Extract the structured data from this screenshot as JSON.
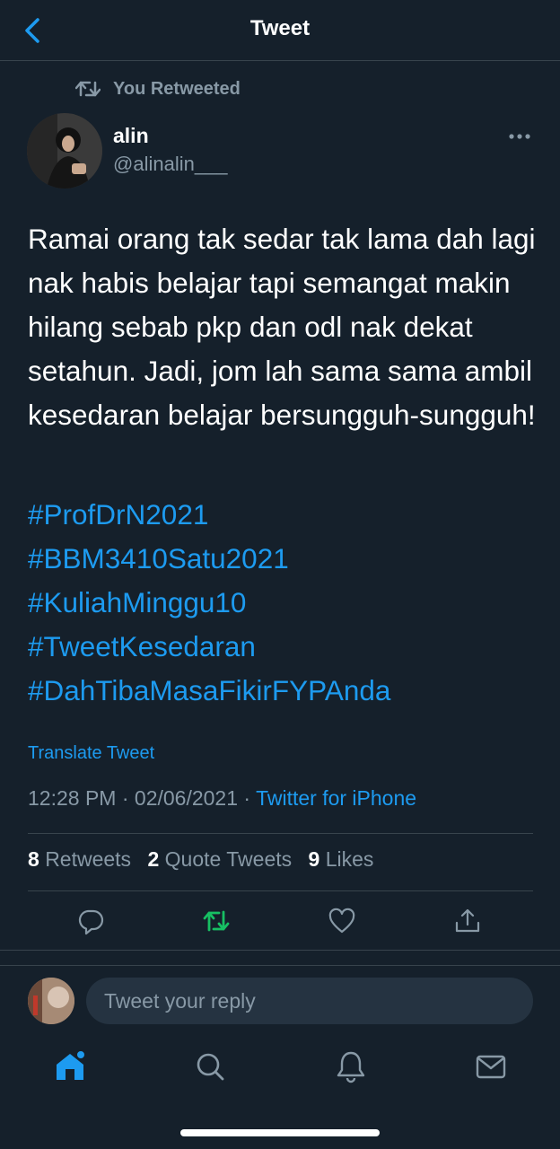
{
  "header": {
    "title": "Tweet",
    "back_icon": "chevron-left-icon"
  },
  "retweet_banner": {
    "icon": "retweet-icon",
    "label": "You Retweeted"
  },
  "author": {
    "name": "alin",
    "handle": "@alinalin___"
  },
  "tweet": {
    "text": "Ramai orang tak sedar tak lama dah lagi nak habis belajar tapi semangat makin hilang sebab pkp dan odl nak dekat setahun. Jadi, jom lah sama sama ambil kesedaran belajar bersungguh-sungguh!",
    "hashtags": [
      "#ProfDrN2021",
      "#BBM3410Satu2021",
      "#KuliahMinggu10",
      "#TweetKesedaran",
      "#DahTibaMasaFikirFYPAnda"
    ],
    "translate_label": "Translate Tweet",
    "time": "12:28 PM",
    "separator": "·",
    "date": "02/06/2021",
    "client": "Twitter for iPhone"
  },
  "stats": {
    "retweets_count": "8",
    "retweets_label": "Retweets",
    "quotes_count": "2",
    "quotes_label": "Quote Tweets",
    "likes_count": "9",
    "likes_label": "Likes"
  },
  "actions": [
    "reply-icon",
    "retweet-icon",
    "like-icon",
    "share-icon"
  ],
  "reply": {
    "placeholder": "Tweet your reply"
  },
  "tabbar": [
    "home-icon",
    "search-icon",
    "notifications-icon",
    "messages-icon"
  ],
  "colors": {
    "background": "#15202b",
    "accent": "#1d9bf0",
    "secondary_text": "#8899a6",
    "retweeted": "#17bf63",
    "divider": "#38444d"
  }
}
